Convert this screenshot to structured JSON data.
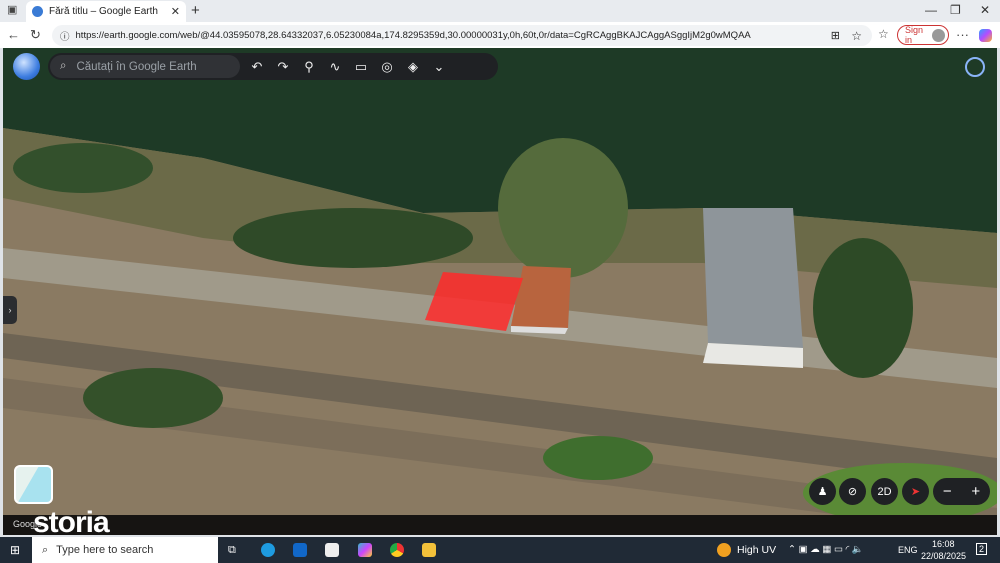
{
  "browser": {
    "tab_title": "Fără titlu – Google Earth",
    "url": "https://earth.google.com/web/@44.03595078,28.64332037,6.05230084a,174.8295359d,30.00000031y,0h,60t,0r/data=CgRCAggBKAJCAggASggIjM2g0wMQAA",
    "sign_in": "Sign in"
  },
  "earth": {
    "search_placeholder": "Căutați în Google Earth",
    "view_2d": "2D",
    "attribution": "Google",
    "watermark": "storia",
    "highlight_color": "#ff2a2a"
  },
  "taskbar": {
    "search_placeholder": "Type here to search",
    "weather": "High UV",
    "language": "ENG",
    "time": "16:08",
    "date": "22/08/2025",
    "notifications": "2"
  }
}
